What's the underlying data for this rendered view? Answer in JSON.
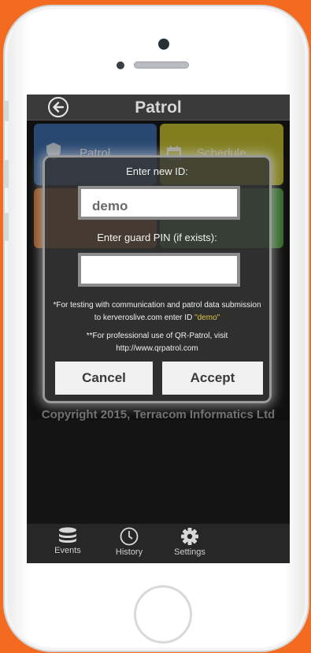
{
  "header": {
    "title": "Patrol"
  },
  "tiles": [
    {
      "label": "Patrol",
      "color": "#3b6fb0"
    },
    {
      "label": "Schedule",
      "color": "#c9c62a"
    },
    {
      "label": "",
      "color": "#d9772a"
    },
    {
      "label": "",
      "color": "#4e9e3c"
    }
  ],
  "copyright": "Copyright 2015, Terracom Informatics Ltd",
  "dialog": {
    "id_label": "Enter new ID:",
    "id_value": "demo",
    "pin_label": "Enter guard PIN (if exists):",
    "pin_value": "",
    "note1_prefix": "*For testing with communication and patrol data submission to kerveroslive.com enter ID ",
    "note1_highlight": "\"demo\"",
    "note2": "**For professional use of QR-Patrol, visit http://www.qrpatrol.com",
    "cancel_label": "Cancel",
    "accept_label": "Accept"
  },
  "tabbar": [
    {
      "label": "Events",
      "icon": "database-icon"
    },
    {
      "label": "History",
      "icon": "clock-icon"
    },
    {
      "label": "Settings",
      "icon": "gear-icon"
    }
  ],
  "colors": {
    "background": "#f26b21",
    "highlight": "#e6c64a"
  }
}
